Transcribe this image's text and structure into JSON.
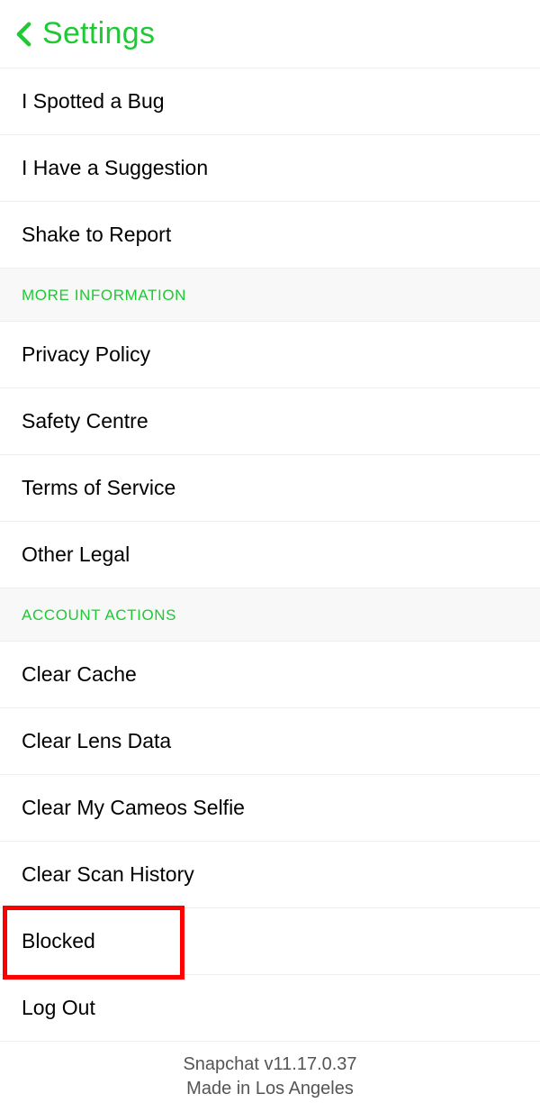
{
  "header": {
    "title": "Settings"
  },
  "feedback_items": [
    "I Spotted a Bug",
    "I Have a Suggestion",
    "Shake to Report"
  ],
  "section_more_info": {
    "title": "MORE INFORMATION",
    "items": [
      "Privacy Policy",
      "Safety Centre",
      "Terms of Service",
      "Other Legal"
    ]
  },
  "section_account_actions": {
    "title": "ACCOUNT ACTIONS",
    "items": [
      "Clear Cache",
      "Clear Lens Data",
      "Clear My Cameos Selfie",
      "Clear Scan History",
      "Blocked",
      "Log Out"
    ]
  },
  "footer": {
    "version": "Snapchat v11.17.0.37",
    "made_in": "Made in Los Angeles"
  }
}
